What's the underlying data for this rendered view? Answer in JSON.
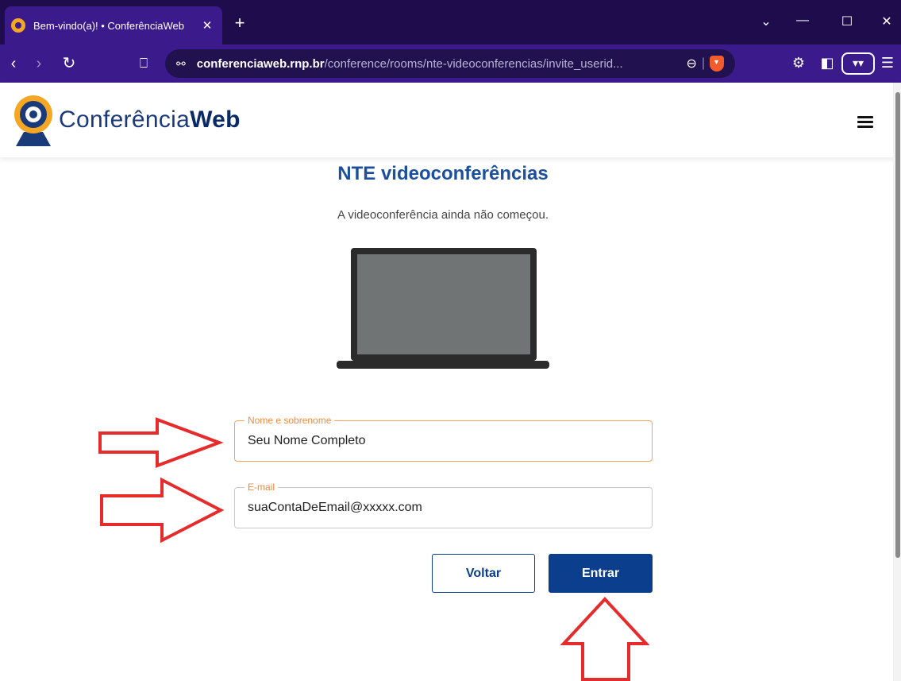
{
  "browser": {
    "tab_title": "Bem-vindo(a)! • ConferênciaWeb",
    "tab_close": "✕",
    "new_tab": "+",
    "url_host": "conferenciaweb.rnp.br",
    "url_path": "/conference/rooms/nte-videoconferencias/invite_userid...",
    "accent": "#3b1a8c",
    "titlebar_color": "#1f0c4d"
  },
  "header": {
    "logo_text_light": "Conferência",
    "logo_text_bold": "Web",
    "menu_icon": "hamburger-icon"
  },
  "main": {
    "room_title": "NTE videoconferências",
    "status": "A videoconferência ainda não começou.",
    "illustration": "laptop-icon"
  },
  "form": {
    "name_label": "Nome e sobrenome",
    "name_placeholder": "Seu Nome Completo",
    "email_label": "E-mail",
    "email_placeholder": "suaContaDeEmail@xxxxx.com",
    "back_label": "Voltar",
    "enter_label": "Entrar"
  },
  "colors": {
    "primary": "#0b3e8c",
    "title_blue": "#1c4f9c",
    "focus_orange": "#f2a35e",
    "annotation_red": "#e52b2b"
  }
}
